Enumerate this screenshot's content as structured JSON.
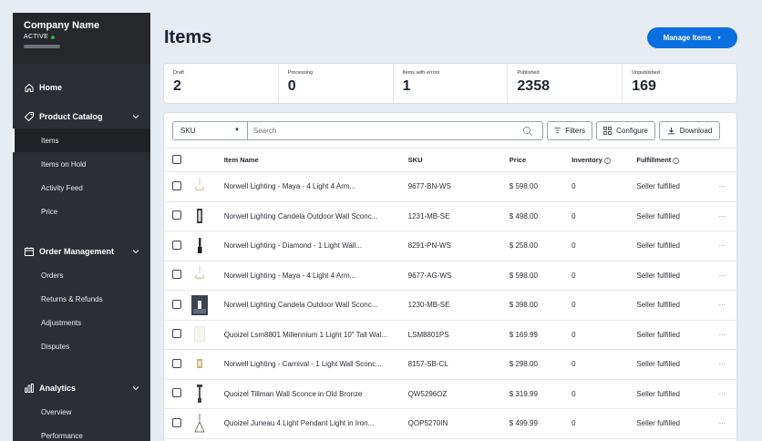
{
  "sidebar": {
    "company_name": "Company Name",
    "status": "ACTIVE",
    "sections": [
      {
        "label": "Home",
        "icon": "home-icon"
      },
      {
        "label": "Product Catalog",
        "icon": "tag-icon",
        "items": [
          "Items",
          "Items on Hold",
          "Activity Feed",
          "Price"
        ],
        "active": "Items"
      },
      {
        "label": "Order Management",
        "icon": "calendar-icon",
        "items": [
          "Orders",
          "Returns & Refunds",
          "Adjustments",
          "Disputes"
        ]
      },
      {
        "label": "Analytics",
        "icon": "bar-chart-icon",
        "items": [
          "Overview",
          "Performance"
        ]
      }
    ]
  },
  "header": {
    "title": "Items",
    "manage_label": "Manage Items"
  },
  "stats": [
    {
      "label": "Draft",
      "value": "2"
    },
    {
      "label": "Processing",
      "value": "0"
    },
    {
      "label": "Items with errors",
      "value": "1"
    },
    {
      "label": "Published",
      "value": "2358"
    },
    {
      "label": "Unpublished",
      "value": "169"
    }
  ],
  "toolbar": {
    "search_field": "SKU",
    "search_placeholder": "Search",
    "filters_label": "Filters",
    "configure_label": "Configure",
    "download_label": "Download"
  },
  "table": {
    "headers": {
      "name": "Item Name",
      "sku": "SKU",
      "price": "Price",
      "inventory": "Inventory",
      "fulfillment": "Fulfillment"
    },
    "rows": [
      {
        "name": "Norwell Lighting - Maya - 4 Light 4 Arm...",
        "sku": "9677-BN-WS",
        "price": "$ 598.00",
        "inventory": "0",
        "fulfillment": "Seller fulfilled",
        "thumb": "chandelier"
      },
      {
        "name": "Norwell Lighting Candela Outdoor Wall Sconc...",
        "sku": "1231-MB-SE",
        "price": "$ 498.00",
        "inventory": "0",
        "fulfillment": "Seller fulfilled",
        "thumb": "sconce-dark"
      },
      {
        "name": "Norwell Lighting - Diamond - 1 Light Wall...",
        "sku": "8291-PN-WS",
        "price": "$ 258.00",
        "inventory": "0",
        "fulfillment": "Seller fulfilled",
        "thumb": "sconce-slim"
      },
      {
        "name": "Norwell Lighting - Maya - 4 Light 4 Arm...",
        "sku": "9677-AG-WS",
        "price": "$ 598.00",
        "inventory": "0",
        "fulfillment": "Seller fulfilled",
        "thumb": "chandelier"
      },
      {
        "name": "Norwell Lighting Candela Outdoor Wall Sconc...",
        "sku": "1230-MB-SE",
        "price": "$ 398.00",
        "inventory": "0",
        "fulfillment": "Seller fulfilled",
        "thumb": "photo"
      },
      {
        "name": "Quoizel Lsm8801 Millennium 1 Light 10\" Tall Wal...",
        "sku": "LSM8801PS",
        "price": "$ 169.99",
        "inventory": "0",
        "fulfillment": "Seller fulfilled",
        "thumb": "shade"
      },
      {
        "name": "Norwell Lighting - Carnival - 1 Light Wall Sconc...",
        "sku": "8157-SB-CL",
        "price": "$ 298.00",
        "inventory": "0",
        "fulfillment": "Seller fulfilled",
        "thumb": "sconce-brass"
      },
      {
        "name": "Quoizel Tillman Wall Sconce in Old Bronze",
        "sku": "QW5296OZ",
        "price": "$ 319.99",
        "inventory": "0",
        "fulfillment": "Seller fulfilled",
        "thumb": "sconce-bronze"
      },
      {
        "name": "Quoizel Juneau 4 Light Pendant Light in Iron...",
        "sku": "QOP5270IN",
        "price": "$ 499.99",
        "inventory": "0",
        "fulfillment": "Seller fulfilled",
        "thumb": "pendant"
      }
    ]
  },
  "colors": {
    "accent": "#0a6fe0",
    "sidebar": "#2b2e33",
    "status": "#2db34a"
  }
}
